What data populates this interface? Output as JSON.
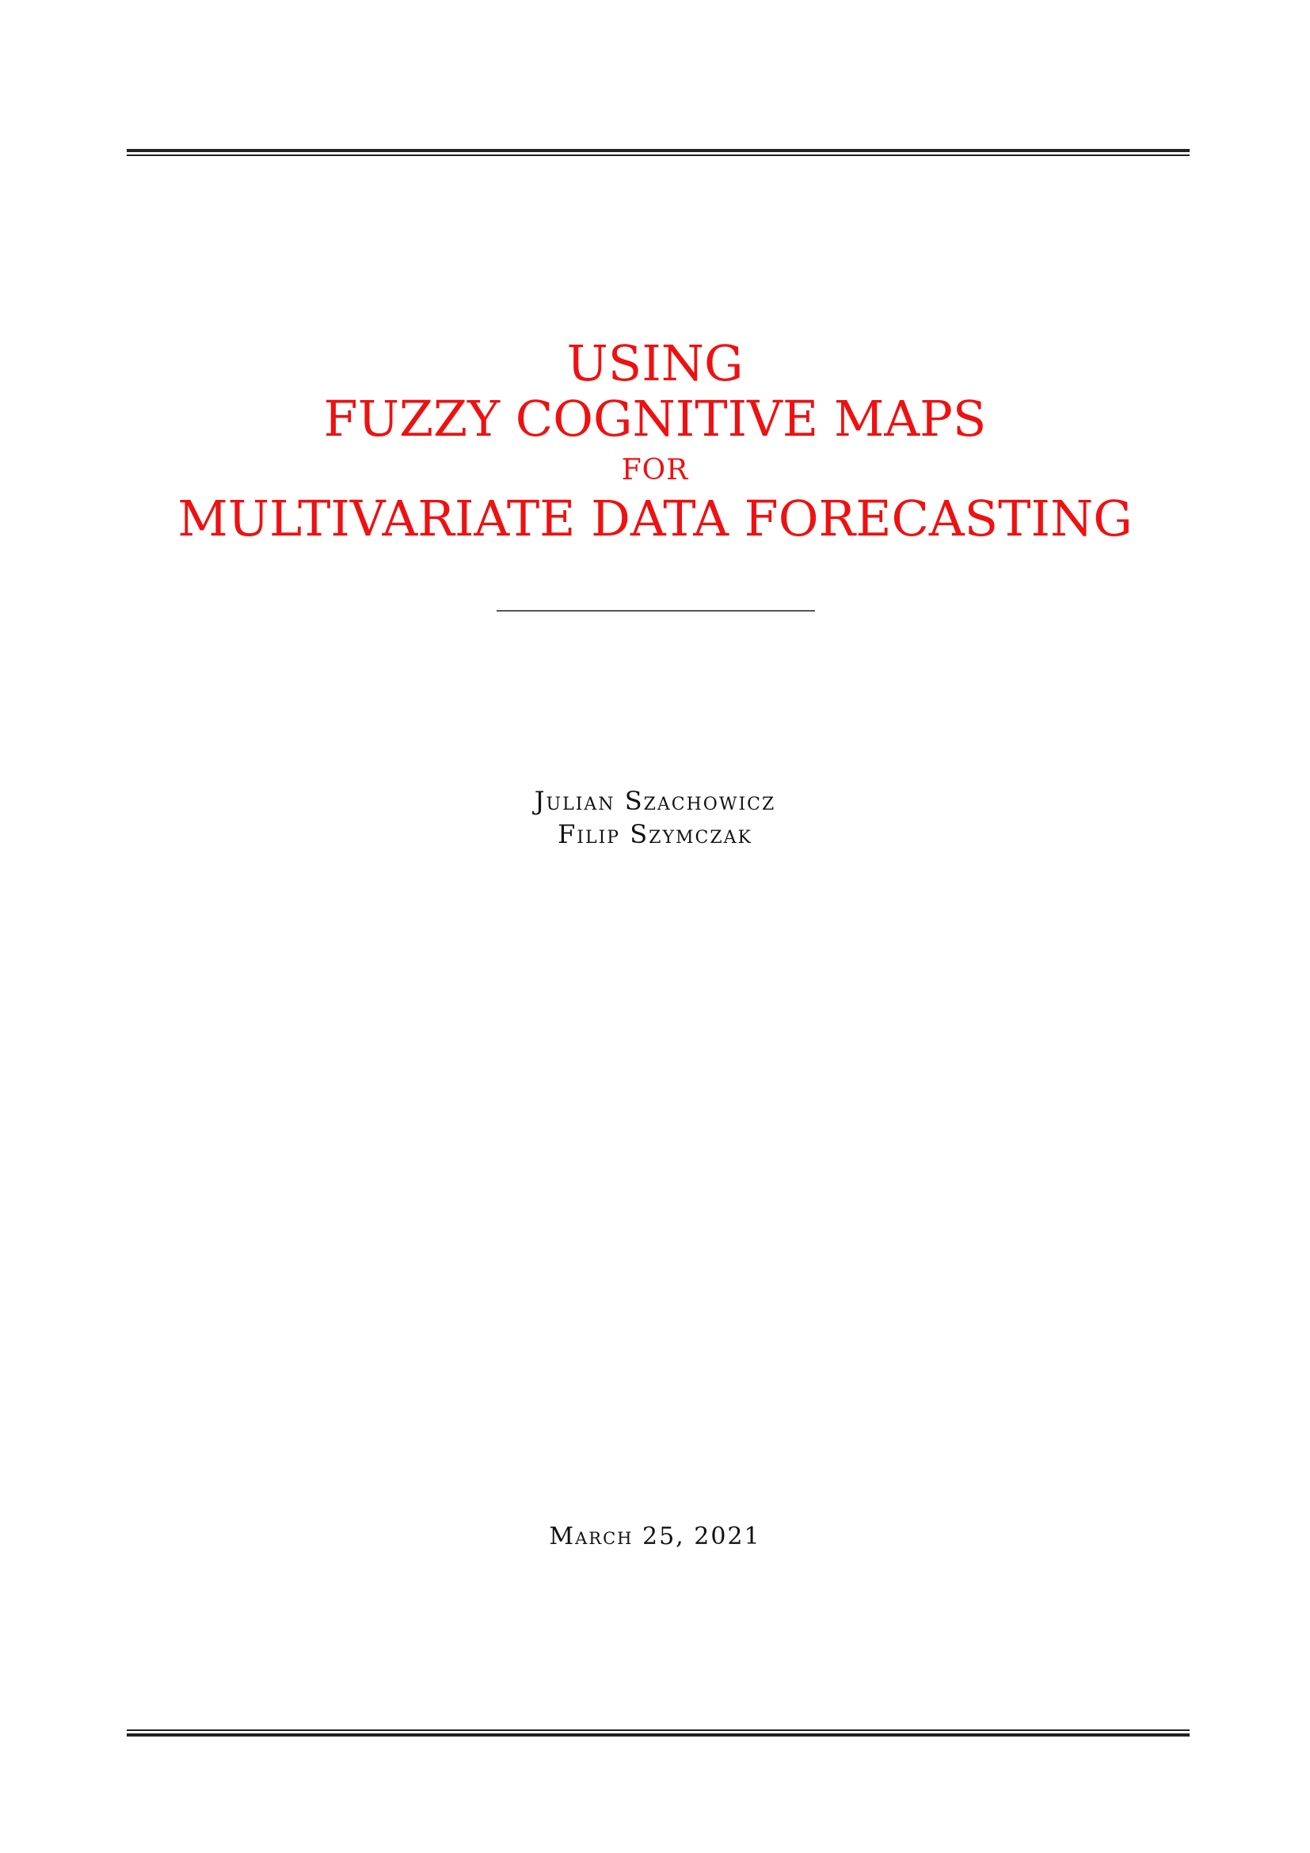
{
  "title": {
    "line1": "USING",
    "line2": "FUZZY COGNITIVE MAPS",
    "line3": "FOR",
    "line4": "MULTIVARIATE DATA FORECASTING"
  },
  "authors": [
    {
      "name": "Julian Szachowicz"
    },
    {
      "name": "Filip Szymczak"
    }
  ],
  "date": "March 25, 2021",
  "colors": {
    "title": "#ee1111",
    "text": "#111111",
    "rules": "#222222"
  }
}
